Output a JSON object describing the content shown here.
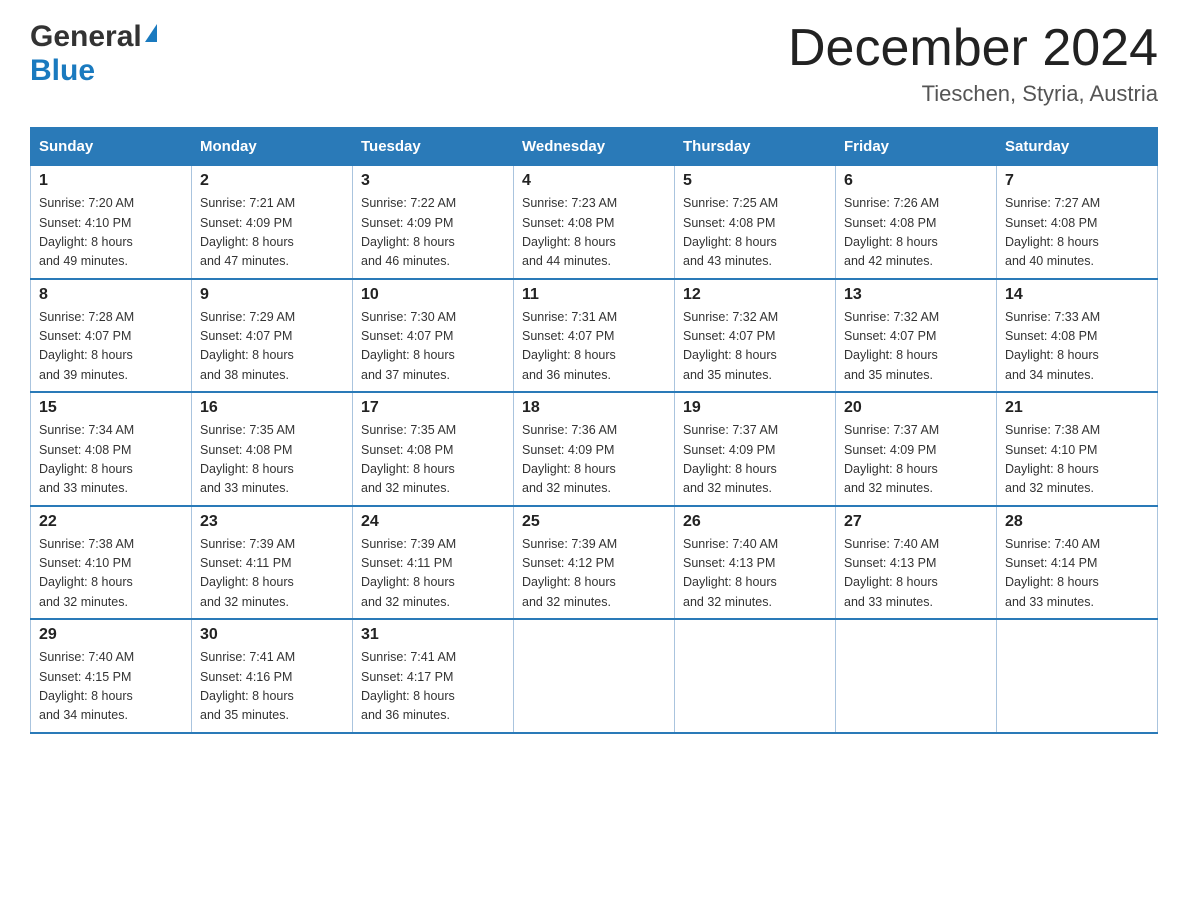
{
  "header": {
    "logo_general": "General",
    "logo_blue": "Blue",
    "month_title": "December 2024",
    "location": "Tieschen, Styria, Austria"
  },
  "columns": [
    "Sunday",
    "Monday",
    "Tuesday",
    "Wednesday",
    "Thursday",
    "Friday",
    "Saturday"
  ],
  "weeks": [
    [
      {
        "day": "1",
        "sunrise": "Sunrise: 7:20 AM",
        "sunset": "Sunset: 4:10 PM",
        "daylight": "Daylight: 8 hours",
        "daylight2": "and 49 minutes."
      },
      {
        "day": "2",
        "sunrise": "Sunrise: 7:21 AM",
        "sunset": "Sunset: 4:09 PM",
        "daylight": "Daylight: 8 hours",
        "daylight2": "and 47 minutes."
      },
      {
        "day": "3",
        "sunrise": "Sunrise: 7:22 AM",
        "sunset": "Sunset: 4:09 PM",
        "daylight": "Daylight: 8 hours",
        "daylight2": "and 46 minutes."
      },
      {
        "day": "4",
        "sunrise": "Sunrise: 7:23 AM",
        "sunset": "Sunset: 4:08 PM",
        "daylight": "Daylight: 8 hours",
        "daylight2": "and 44 minutes."
      },
      {
        "day": "5",
        "sunrise": "Sunrise: 7:25 AM",
        "sunset": "Sunset: 4:08 PM",
        "daylight": "Daylight: 8 hours",
        "daylight2": "and 43 minutes."
      },
      {
        "day": "6",
        "sunrise": "Sunrise: 7:26 AM",
        "sunset": "Sunset: 4:08 PM",
        "daylight": "Daylight: 8 hours",
        "daylight2": "and 42 minutes."
      },
      {
        "day": "7",
        "sunrise": "Sunrise: 7:27 AM",
        "sunset": "Sunset: 4:08 PM",
        "daylight": "Daylight: 8 hours",
        "daylight2": "and 40 minutes."
      }
    ],
    [
      {
        "day": "8",
        "sunrise": "Sunrise: 7:28 AM",
        "sunset": "Sunset: 4:07 PM",
        "daylight": "Daylight: 8 hours",
        "daylight2": "and 39 minutes."
      },
      {
        "day": "9",
        "sunrise": "Sunrise: 7:29 AM",
        "sunset": "Sunset: 4:07 PM",
        "daylight": "Daylight: 8 hours",
        "daylight2": "and 38 minutes."
      },
      {
        "day": "10",
        "sunrise": "Sunrise: 7:30 AM",
        "sunset": "Sunset: 4:07 PM",
        "daylight": "Daylight: 8 hours",
        "daylight2": "and 37 minutes."
      },
      {
        "day": "11",
        "sunrise": "Sunrise: 7:31 AM",
        "sunset": "Sunset: 4:07 PM",
        "daylight": "Daylight: 8 hours",
        "daylight2": "and 36 minutes."
      },
      {
        "day": "12",
        "sunrise": "Sunrise: 7:32 AM",
        "sunset": "Sunset: 4:07 PM",
        "daylight": "Daylight: 8 hours",
        "daylight2": "and 35 minutes."
      },
      {
        "day": "13",
        "sunrise": "Sunrise: 7:32 AM",
        "sunset": "Sunset: 4:07 PM",
        "daylight": "Daylight: 8 hours",
        "daylight2": "and 35 minutes."
      },
      {
        "day": "14",
        "sunrise": "Sunrise: 7:33 AM",
        "sunset": "Sunset: 4:08 PM",
        "daylight": "Daylight: 8 hours",
        "daylight2": "and 34 minutes."
      }
    ],
    [
      {
        "day": "15",
        "sunrise": "Sunrise: 7:34 AM",
        "sunset": "Sunset: 4:08 PM",
        "daylight": "Daylight: 8 hours",
        "daylight2": "and 33 minutes."
      },
      {
        "day": "16",
        "sunrise": "Sunrise: 7:35 AM",
        "sunset": "Sunset: 4:08 PM",
        "daylight": "Daylight: 8 hours",
        "daylight2": "and 33 minutes."
      },
      {
        "day": "17",
        "sunrise": "Sunrise: 7:35 AM",
        "sunset": "Sunset: 4:08 PM",
        "daylight": "Daylight: 8 hours",
        "daylight2": "and 32 minutes."
      },
      {
        "day": "18",
        "sunrise": "Sunrise: 7:36 AM",
        "sunset": "Sunset: 4:09 PM",
        "daylight": "Daylight: 8 hours",
        "daylight2": "and 32 minutes."
      },
      {
        "day": "19",
        "sunrise": "Sunrise: 7:37 AM",
        "sunset": "Sunset: 4:09 PM",
        "daylight": "Daylight: 8 hours",
        "daylight2": "and 32 minutes."
      },
      {
        "day": "20",
        "sunrise": "Sunrise: 7:37 AM",
        "sunset": "Sunset: 4:09 PM",
        "daylight": "Daylight: 8 hours",
        "daylight2": "and 32 minutes."
      },
      {
        "day": "21",
        "sunrise": "Sunrise: 7:38 AM",
        "sunset": "Sunset: 4:10 PM",
        "daylight": "Daylight: 8 hours",
        "daylight2": "and 32 minutes."
      }
    ],
    [
      {
        "day": "22",
        "sunrise": "Sunrise: 7:38 AM",
        "sunset": "Sunset: 4:10 PM",
        "daylight": "Daylight: 8 hours",
        "daylight2": "and 32 minutes."
      },
      {
        "day": "23",
        "sunrise": "Sunrise: 7:39 AM",
        "sunset": "Sunset: 4:11 PM",
        "daylight": "Daylight: 8 hours",
        "daylight2": "and 32 minutes."
      },
      {
        "day": "24",
        "sunrise": "Sunrise: 7:39 AM",
        "sunset": "Sunset: 4:11 PM",
        "daylight": "Daylight: 8 hours",
        "daylight2": "and 32 minutes."
      },
      {
        "day": "25",
        "sunrise": "Sunrise: 7:39 AM",
        "sunset": "Sunset: 4:12 PM",
        "daylight": "Daylight: 8 hours",
        "daylight2": "and 32 minutes."
      },
      {
        "day": "26",
        "sunrise": "Sunrise: 7:40 AM",
        "sunset": "Sunset: 4:13 PM",
        "daylight": "Daylight: 8 hours",
        "daylight2": "and 32 minutes."
      },
      {
        "day": "27",
        "sunrise": "Sunrise: 7:40 AM",
        "sunset": "Sunset: 4:13 PM",
        "daylight": "Daylight: 8 hours",
        "daylight2": "and 33 minutes."
      },
      {
        "day": "28",
        "sunrise": "Sunrise: 7:40 AM",
        "sunset": "Sunset: 4:14 PM",
        "daylight": "Daylight: 8 hours",
        "daylight2": "and 33 minutes."
      }
    ],
    [
      {
        "day": "29",
        "sunrise": "Sunrise: 7:40 AM",
        "sunset": "Sunset: 4:15 PM",
        "daylight": "Daylight: 8 hours",
        "daylight2": "and 34 minutes."
      },
      {
        "day": "30",
        "sunrise": "Sunrise: 7:41 AM",
        "sunset": "Sunset: 4:16 PM",
        "daylight": "Daylight: 8 hours",
        "daylight2": "and 35 minutes."
      },
      {
        "day": "31",
        "sunrise": "Sunrise: 7:41 AM",
        "sunset": "Sunset: 4:17 PM",
        "daylight": "Daylight: 8 hours",
        "daylight2": "and 36 minutes."
      },
      null,
      null,
      null,
      null
    ]
  ]
}
